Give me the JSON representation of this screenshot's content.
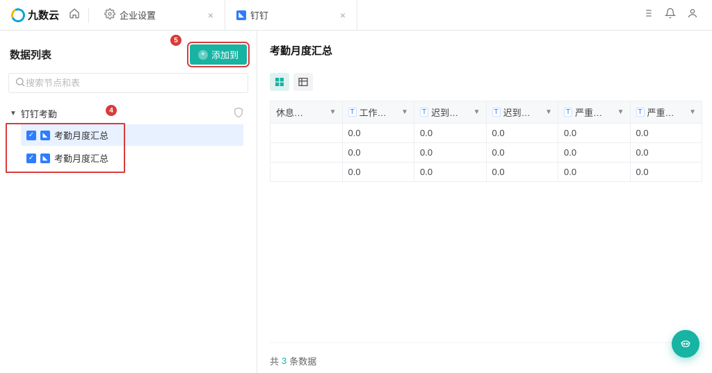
{
  "brand": "九数云",
  "tabs": [
    {
      "label": "企业设置"
    },
    {
      "label": "钉钉"
    }
  ],
  "left": {
    "title": "数据列表",
    "add_button": "添加到",
    "search_placeholder": "搜索节点和表",
    "node": {
      "label": "钉钉考勤",
      "children": [
        {
          "label": "考勤月度汇总",
          "selected": true
        },
        {
          "label": "考勤月度汇总",
          "selected": false
        }
      ]
    },
    "badges": {
      "four": "4",
      "five": "5"
    }
  },
  "right": {
    "title": "考勤月度汇总",
    "columns": [
      "休息…",
      "工作…",
      "迟到…",
      "迟到…",
      "严重…",
      "严重…"
    ],
    "rows": [
      [
        "",
        "0.0",
        "0.0",
        "0.0",
        "0.0",
        "0.0"
      ],
      [
        "",
        "0.0",
        "0.0",
        "0.0",
        "0.0",
        "0.0"
      ],
      [
        "",
        "0.0",
        "0.0",
        "0.0",
        "0.0",
        "0.0"
      ]
    ],
    "footer_prefix": "共",
    "footer_count": "3",
    "footer_suffix": "条数据"
  }
}
